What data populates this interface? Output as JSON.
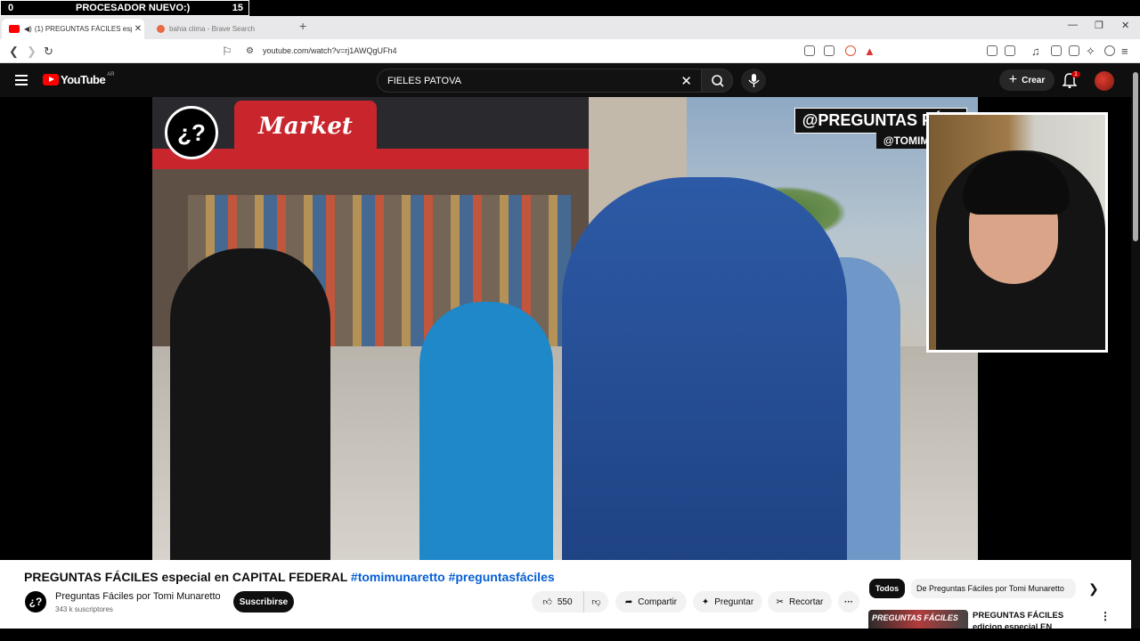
{
  "overlay": {
    "left_num": "0",
    "label": "PROCESADOR NUEVO:)",
    "right_num": "15"
  },
  "browser": {
    "tabs": [
      {
        "title": "(1) PREGUNTAS FÁCILES espe",
        "favicon_color": "#ff0000"
      },
      {
        "title": "bahia clima - Brave Search",
        "favicon_color": "#e86b43"
      }
    ],
    "url": "youtube.com/watch?v=rj1AWQgUFh4"
  },
  "youtube": {
    "logo_text": "YouTube",
    "country_code": "AR",
    "search_value": "FIELES PATOVA",
    "create_label": "Crear",
    "notif_count": "1"
  },
  "video": {
    "logo_glyph": "¿?",
    "market_text": "Market",
    "overlay_title": "@PREGUNTAS FÁCI",
    "overlay_handle": "@TOMIMUNAR"
  },
  "info": {
    "title_main": "PREGUNTAS FÁCILES especial en CAPITAL FEDERAL ",
    "title_tags": "#tomimunaretto #preguntasfáciles",
    "channel_name": "Preguntas Fáciles por Tomi Munaretto",
    "subscribers": "343 k suscriptores",
    "subscribe_label": "Suscribirse",
    "likes": "550",
    "share_label": "Compartir",
    "ask_label": "Preguntar",
    "clip_label": "Recortar"
  },
  "sidebar": {
    "chip_all": "Todos",
    "chip_channel": "De Preguntas Fáciles por Tomi Munaretto",
    "rec_thumb_text": "PREGUNTAS FÁCILES",
    "rec_title": "PREGUNTAS FÁCILES edicion especial EN CAPITAL"
  },
  "colors": {
    "yt_red": "#ff0000",
    "link_blue": "#065fd4",
    "header_bg": "#0f0f0f"
  }
}
